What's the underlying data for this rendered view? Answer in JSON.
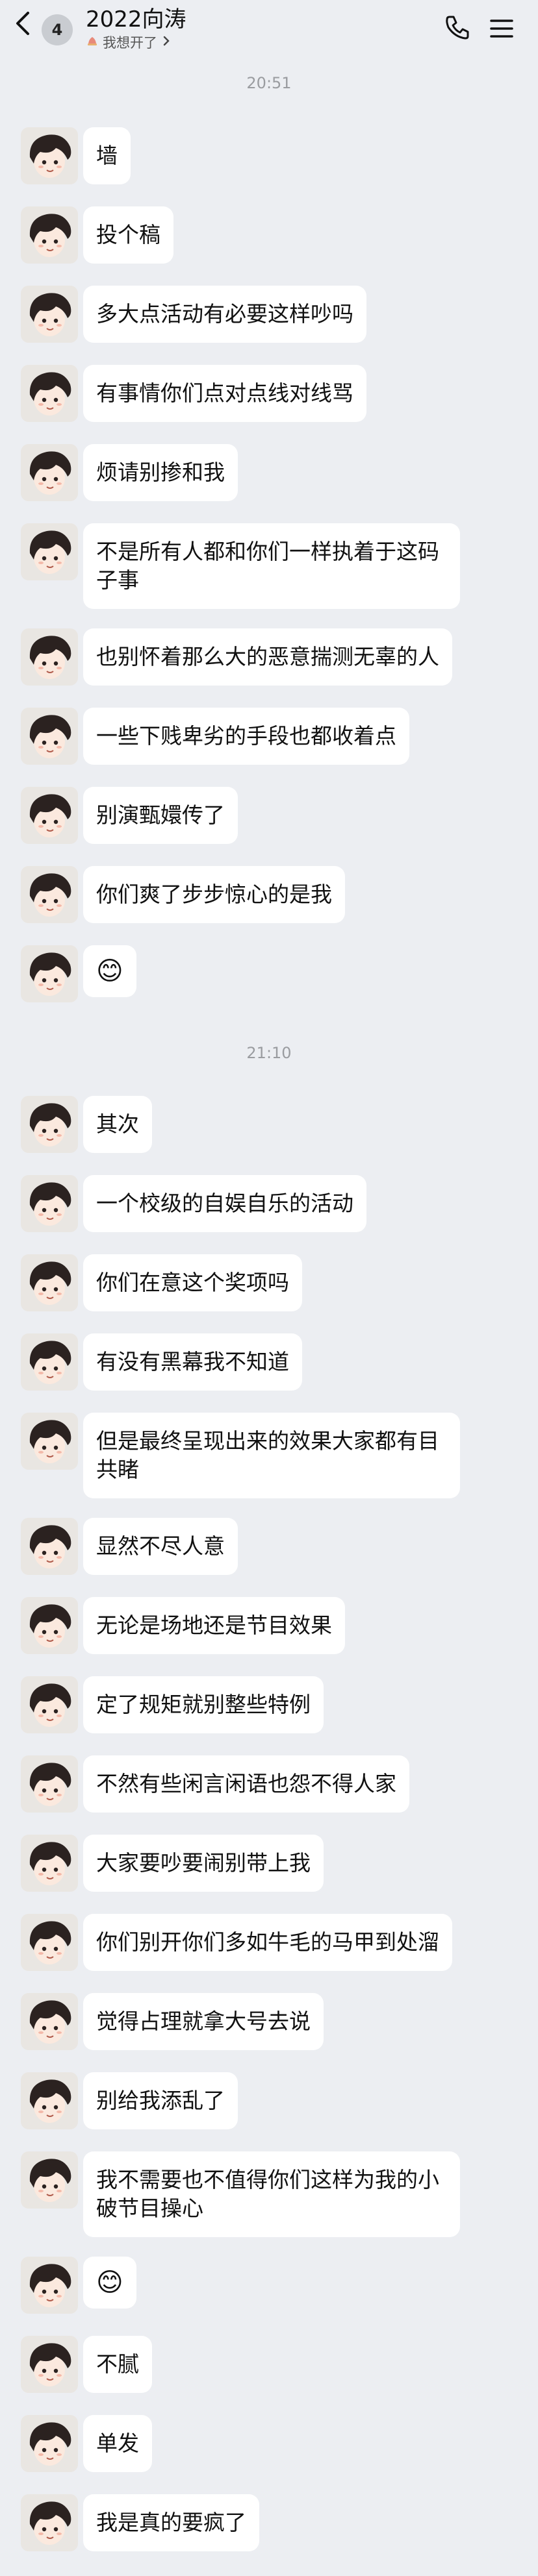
{
  "header": {
    "back_icon": "chevron-left-icon",
    "unread_count": "4",
    "title": "2022向涛",
    "status_text": "我想开了",
    "status_icon": "status-flame-icon",
    "call_icon": "phone-icon",
    "menu_icon": "menu-icon"
  },
  "timestamps": [
    "20:51",
    "21:10"
  ],
  "messages": [
    {
      "text": "墙"
    },
    {
      "text": "投个稿"
    },
    {
      "text": "多大点活动有必要这样吵吗"
    },
    {
      "text": "有事情你们点对点线对线骂"
    },
    {
      "text": "烦请别掺和我"
    },
    {
      "text": "不是所有人都和你们一样执着于这码子事"
    },
    {
      "text": "也别怀着那么大的恶意揣测无辜的人"
    },
    {
      "text": "一些下贱卑劣的手段也都收着点"
    },
    {
      "text": "别演甄嬛传了"
    },
    {
      "text": "你们爽了步步惊心的是我"
    },
    {
      "text": "😊"
    },
    {
      "text": "其次"
    },
    {
      "text": "一个校级的自娱自乐的活动"
    },
    {
      "text": "你们在意这个奖项吗"
    },
    {
      "text": "有没有黑幕我不知道"
    },
    {
      "text": "但是最终呈现出来的效果大家都有目共睹"
    },
    {
      "text": "显然不尽人意"
    },
    {
      "text": "无论是场地还是节目效果"
    },
    {
      "text": "定了规矩就别整些特例"
    },
    {
      "text": "不然有些闲言闲语也怨不得人家"
    },
    {
      "text": "大家要吵要闹别带上我"
    },
    {
      "text": "你们别开你们多如牛毛的马甲到处溜"
    },
    {
      "text": "觉得占理就拿大号去说"
    },
    {
      "text": "别给我添乱了"
    },
    {
      "text": "我不需要也不值得你们这样为我的小破节目操心"
    },
    {
      "text": "😊"
    },
    {
      "text": "不腻"
    },
    {
      "text": "单发"
    },
    {
      "text": "我是真的要疯了"
    }
  ]
}
